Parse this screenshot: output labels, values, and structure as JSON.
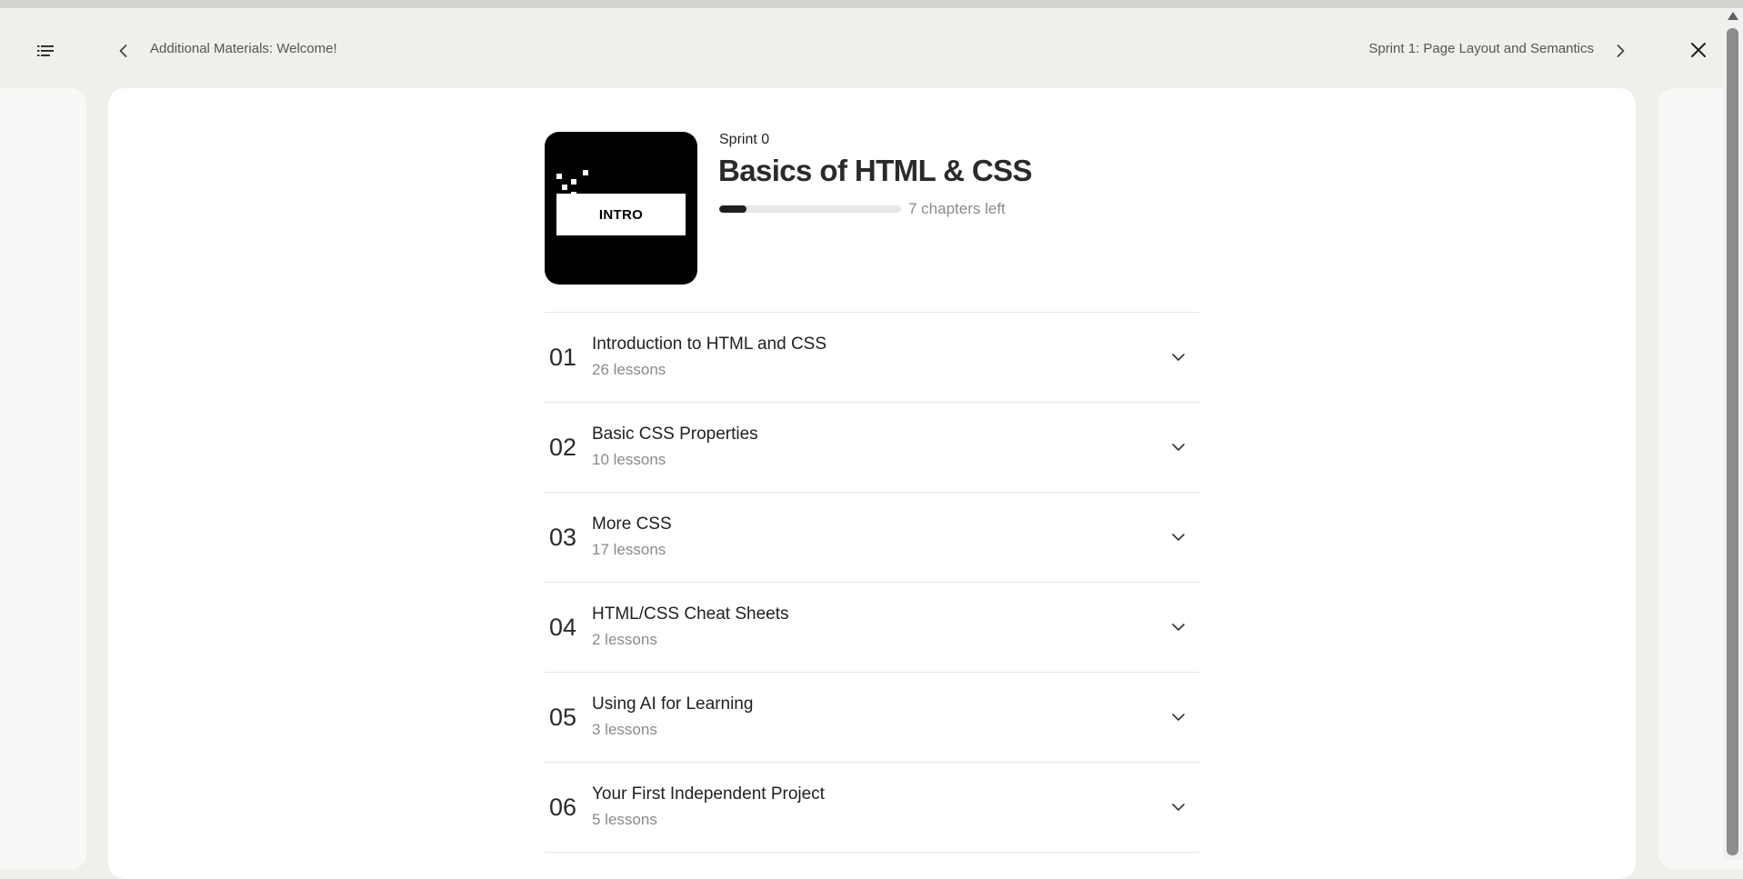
{
  "topbar": {
    "menu_icon": "list-icon",
    "prev_icon": "chevron-left-icon",
    "prev_label": "Additional Materials: Welcome!",
    "next_label": "Sprint 1: Page Layout and Semantics",
    "next_icon": "chevron-right-icon",
    "close_icon": "close-icon"
  },
  "course": {
    "cover_label": "INTRO",
    "sprint_label": "Sprint 0",
    "title": "Basics of HTML & CSS",
    "progress_fraction": 0.15,
    "progress_text": "7 chapters left"
  },
  "chapters": [
    {
      "number": "01",
      "title": "Introduction to HTML and CSS",
      "lessons": "26 lessons"
    },
    {
      "number": "02",
      "title": "Basic CSS Properties",
      "lessons": "10 lessons"
    },
    {
      "number": "03",
      "title": "More CSS",
      "lessons": "17 lessons"
    },
    {
      "number": "04",
      "title": "HTML/CSS Cheat Sheets",
      "lessons": "2 lessons"
    },
    {
      "number": "05",
      "title": "Using AI for Learning",
      "lessons": "3 lessons"
    },
    {
      "number": "06",
      "title": "Your First Independent Project",
      "lessons": "5 lessons"
    }
  ],
  "colors": {
    "background": "#f0efeb",
    "card": "#ffffff",
    "text": "#1f1f1f",
    "muted": "#8a8a8a",
    "accent_dark": "#1f1f1f"
  }
}
